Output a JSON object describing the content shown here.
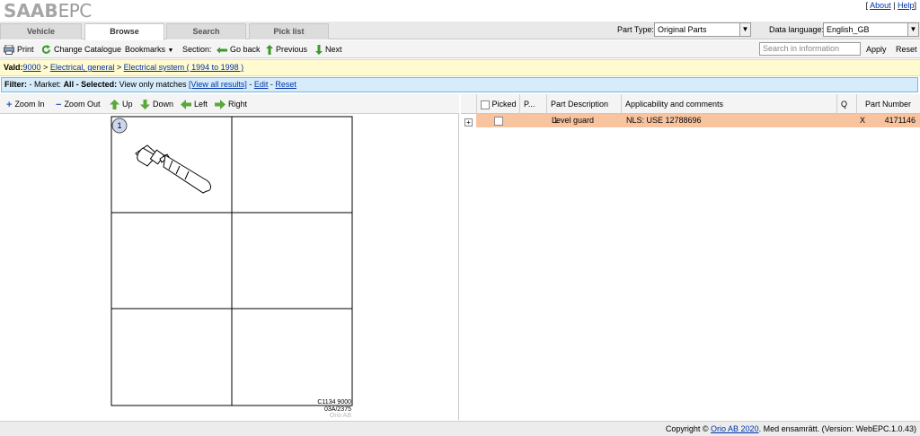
{
  "header": {
    "logo_brand": "SAAB",
    "logo_suffix": "EPC",
    "links": {
      "about": "About",
      "help": "Help"
    }
  },
  "tabs": [
    {
      "label": "Vehicle",
      "active": false
    },
    {
      "label": "Browse",
      "active": true
    },
    {
      "label": "Search",
      "active": false
    },
    {
      "label": "Pick list",
      "active": false
    }
  ],
  "part_type": {
    "label": "Part Type:",
    "value": "Original Parts"
  },
  "data_language": {
    "label": "Data language:",
    "value": "English_GB"
  },
  "toolbar": {
    "print": "Print",
    "change_catalogue": "Change Catalogue",
    "bookmarks": "Bookmarks",
    "section_label": "Section:",
    "go_back": "Go back",
    "previous": "Previous",
    "next": "Next",
    "search_placeholder": "Search in information",
    "apply": "Apply",
    "reset": "Reset"
  },
  "breadcrumb": {
    "label": "Vald:",
    "items": [
      "9000",
      "Electrical, general",
      "Electrical system ( 1994 to 1998 )"
    ]
  },
  "filter": {
    "label": "Filter:",
    "market_text": "- Market:",
    "market_value": "All",
    "selected_text": "- Selected:",
    "selected_value": "View only matches",
    "view_all": "[View all results]",
    "edit": "Edit",
    "reset": "Reset"
  },
  "image_tools": {
    "zoom_in": "Zoom In",
    "zoom_out": "Zoom Out",
    "up": "Up",
    "down": "Down",
    "left": "Left",
    "right": "Right"
  },
  "illustration": {
    "callout": "1",
    "code_line1": "C1134 9000",
    "code_line2": "03A/2375",
    "watermark": "Orio AB"
  },
  "table": {
    "columns": [
      "Picked",
      "P...",
      "Part Description",
      "Applicability and comments",
      "Q",
      "Part Number"
    ],
    "rows": [
      {
        "expand": "+",
        "position": "1",
        "description": "Level guard",
        "comments": "NLS: USE 12788696",
        "q": "X",
        "part_number": "4171146"
      }
    ]
  },
  "footer": {
    "prefix": "Copyright ©",
    "link": "Orio AB 2020",
    "suffix": ". Med ensamrätt. (Version: WebEPC.1.0.43)"
  },
  "colors": {
    "highlight_row": "#f8c4a0",
    "filter_bg": "#d6ecfa",
    "crumb_bg": "#fffad0"
  }
}
